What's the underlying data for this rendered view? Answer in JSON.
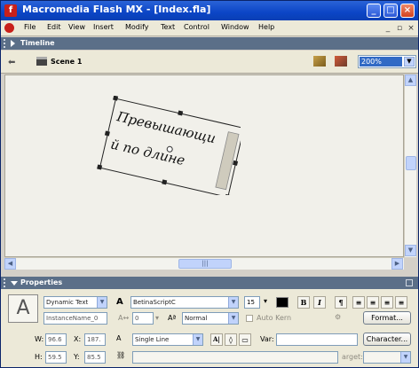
{
  "window": {
    "title": "Macromedia Flash MX - [Index.fla]"
  },
  "menu": [
    "File",
    "Edit",
    "View",
    "Insert",
    "Modify",
    "Text",
    "Control",
    "Window",
    "Help"
  ],
  "timeline": {
    "label": "Timeline"
  },
  "scene": {
    "label": "Scene 1",
    "zoom": "200%"
  },
  "stage": {
    "text_lines": [
      "Превышающи",
      "й по длине"
    ]
  },
  "properties": {
    "label": "Properties",
    "text_type": "Dynamic Text",
    "instance_name": "InstanceName_0",
    "font": "BetinaScriptC",
    "font_size": "15",
    "bold": "B",
    "italic": "I",
    "char_pos": "Normal",
    "auto_kern": "Auto Kern",
    "format_button": "Format...",
    "line_type": "Single Line",
    "ab": "A|",
    "var_label": "Var:",
    "character_button": "Character...",
    "target_label": "arget:",
    "w_label": "W:",
    "w_value": "96.6",
    "x_label": "X:",
    "x_value": "187.",
    "h_label": "H:",
    "h_value": "59.5",
    "y_label": "Y:",
    "y_value": "85.5",
    "tracking_value": "0"
  }
}
